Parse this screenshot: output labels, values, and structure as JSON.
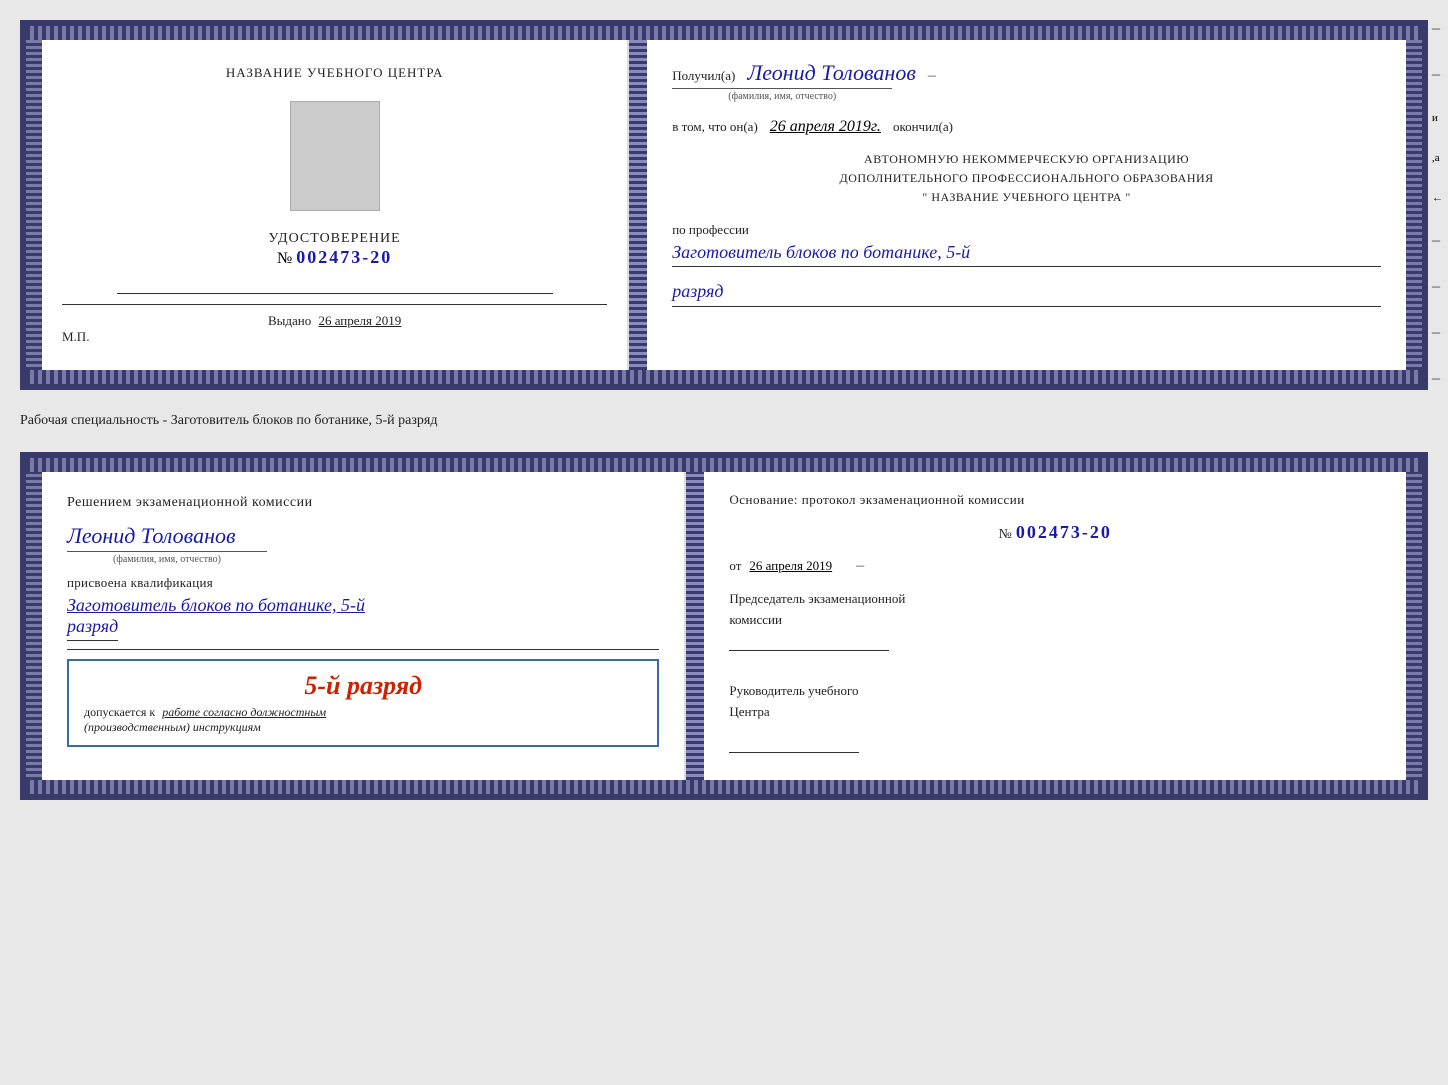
{
  "page": {
    "background": "#e8e8e8"
  },
  "card1": {
    "left": {
      "title": "НАЗВАНИЕ УЧЕБНОГО ЦЕНТРА",
      "photo_alt": "photo",
      "udost_label": "УДОСТОВЕРЕНИЕ",
      "number_prefix": "№",
      "number": "002473-20",
      "issued_label": "Выдано",
      "issued_date": "26 апреля 2019",
      "mp_label": "М.П."
    },
    "right": {
      "received_prefix": "Получил(а)",
      "recipient_name": "Леонид Толованов",
      "fio_label": "(фамилия, имя, отчество)",
      "date_prefix": "в том, что он(а)",
      "date_value": "26 апреля 2019г.",
      "finished_label": "окончил(а)",
      "org_line1": "АВТОНОМНУЮ НЕКОММЕРЧЕСКУЮ ОРГАНИЗАЦИЮ",
      "org_line2": "ДОПОЛНИТЕЛЬНОГО ПРОФЕССИОНАЛЬНОГО ОБРАЗОВАНИЯ",
      "org_line3": "\" НАЗВАНИЕ УЧЕБНОГО ЦЕНТРА \"",
      "profession_prefix": "по профессии",
      "profession_name": "Заготовитель блоков по ботанике, 5-й",
      "razryad": "разряд"
    }
  },
  "specialty_label": "Рабочая специальность - Заготовитель блоков по ботанике, 5-й разряд",
  "card2": {
    "left": {
      "decision_text": "Решением экзаменационной комиссии",
      "person_name": "Леонид Толованов",
      "fio_label": "(фамилия, имя, отчество)",
      "assigned_label": "присвоена квалификация",
      "profession": "Заготовитель блоков по ботанике, 5-й",
      "razryad": "разряд",
      "rank_display": "5-й разряд",
      "допускается_prefix": "допускается к",
      "допускается_text": "работе согласно должностным",
      "инструкциям": "(производственным) инструкциям"
    },
    "right": {
      "basis_text": "Основание: протокол экзаменационной комиссии",
      "number_prefix": "№",
      "protocol_number": "002473-20",
      "date_prefix": "от",
      "protocol_date": "26 апреля 2019",
      "chairman_line1": "Председатель экзаменационной",
      "chairman_line2": "комиссии",
      "director_line1": "Руководитель учебного",
      "director_line2": "Центра"
    }
  }
}
